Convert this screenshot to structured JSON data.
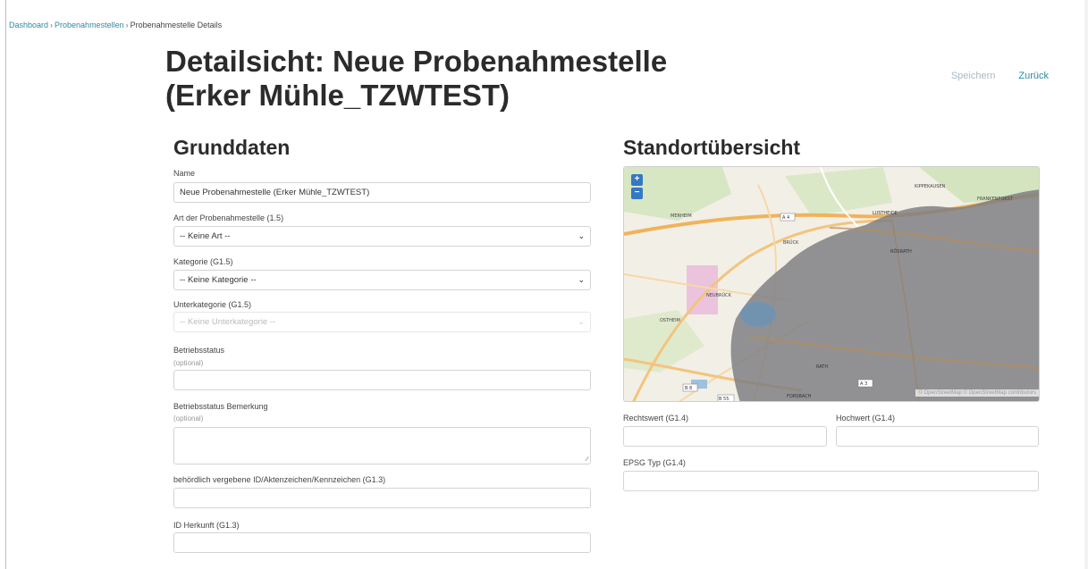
{
  "breadcrumb": {
    "items": [
      "Dashboard",
      "Probenahmestellen"
    ],
    "current": "Probenahmestelle Details",
    "separator": "›"
  },
  "page": {
    "title": "Detailsicht: Neue Probenahmestelle (Erker Mühle_TZWTEST)"
  },
  "actions": {
    "save_label": "Speichern",
    "back_label": "Zurück"
  },
  "grunddaten": {
    "heading": "Grunddaten",
    "name_label": "Name",
    "name_value": "Neue Probenahmestelle (Erker Mühle_TZWTEST)",
    "art_label": "Art der Probenahmestelle (1.5)",
    "art_value": "-- Keine Art --",
    "kategorie_label": "Kategorie (G1.5)",
    "kategorie_value": "-- Keine Kategorie --",
    "unterkategorie_label": "Unterkategorie (G1.5)",
    "unterkategorie_value": "-- Keine Unterkategorie --",
    "betriebsstatus_label": "Betriebsstatus",
    "betriebsstatus_optional": "(optional)",
    "betriebsstatus_value": "",
    "bemerkung_label": "Betriebsstatus Bemerkung",
    "bemerkung_optional": "(optional)",
    "bemerkung_value": "",
    "behoerd_id_label": "behördlich vergebene ID/Aktenzeichen/Kennzeichen (G1.3)",
    "behoerd_id_value": "",
    "herkunft_label": "ID Herkunft (G1.3)",
    "herkunft_value": ""
  },
  "standort": {
    "heading": "Standortübersicht",
    "rechtswert_label": "Rechtswert (G1.4)",
    "rechtswert_value": "",
    "hochwert_label": "Hochwert (G1.4)",
    "hochwert_value": "",
    "epsg_label": "EPSG Typ (G1.4)",
    "epsg_value": ""
  },
  "map": {
    "zoom_in": "+",
    "zoom_out": "−",
    "attribution": "© OpenStreetMap © OpenStreetMap contributors",
    "places": [
      "MERHEIM",
      "BRÜCK",
      "LUSTHEIDE",
      "RÖSRATH",
      "NEUBRÜCK",
      "OSTHEIM",
      "RATH",
      "FORSBACH",
      "FRANKENFORST",
      "KIPPEKAUSEN"
    ],
    "road_labels": [
      "A 4",
      "A 3",
      "B 8",
      "B 55"
    ],
    "colors": {
      "land": "#f2efe6",
      "road": "#f0b35a",
      "forest": "#c8dfb0",
      "overlay": "#7b7c80",
      "water": "#8fb8d8"
    }
  },
  "colors": {
    "accent": "#2e8aa6",
    "save_disabled": "#a9b9bf",
    "zoom_button": "#3478c6"
  }
}
